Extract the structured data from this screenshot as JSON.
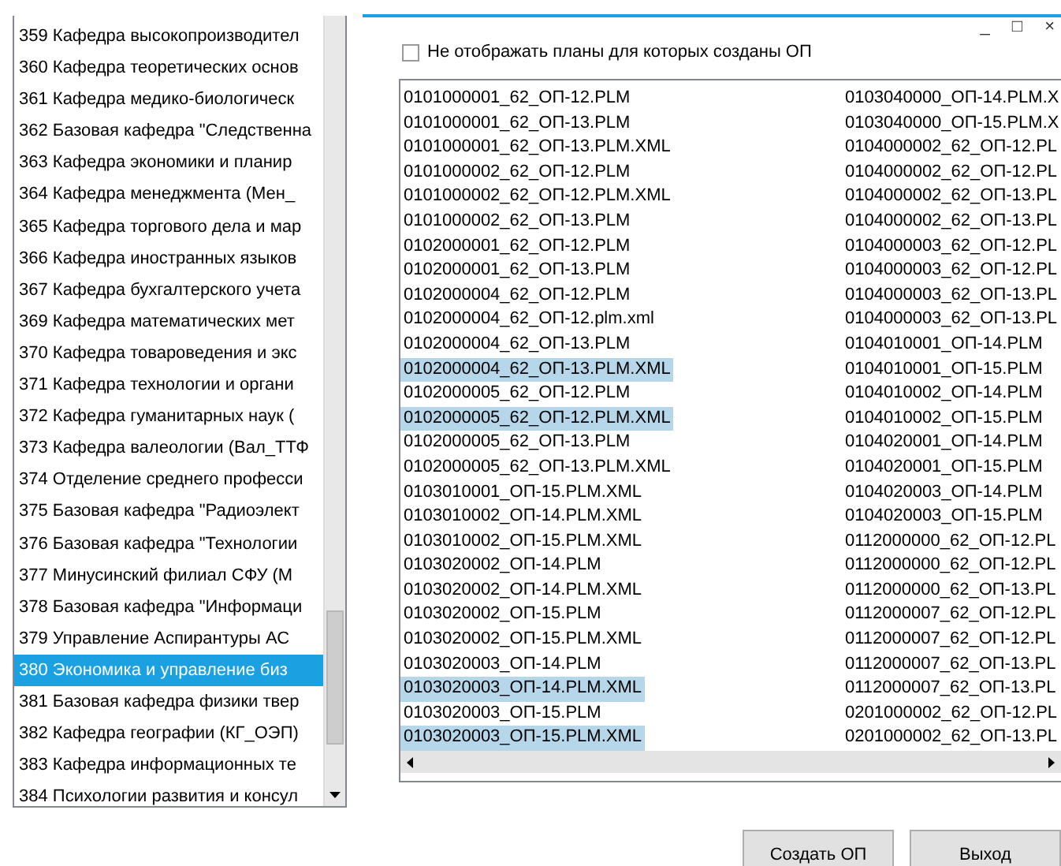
{
  "departments": [
    {
      "label": "359 Кафедра высокопроизводител",
      "selected": false
    },
    {
      "label": "360 Кафедра теоретических основ",
      "selected": false
    },
    {
      "label": "361 Кафедра медико-биологическ",
      "selected": false
    },
    {
      "label": "362 Базовая кафедра \"Следственна",
      "selected": false
    },
    {
      "label": "363 Кафедра экономики и планир",
      "selected": false
    },
    {
      "label": "364 Кафедра менеджмента (Мен_",
      "selected": false
    },
    {
      "label": "365 Кафедра торгового дела и мар",
      "selected": false
    },
    {
      "label": "366 Кафедра иностранных языков",
      "selected": false
    },
    {
      "label": "367 Кафедра бухгалтерского учета",
      "selected": false
    },
    {
      "label": "369 Кафедра математических мет",
      "selected": false
    },
    {
      "label": "370 Кафедра товароведения и экс",
      "selected": false
    },
    {
      "label": "371 Кафедра технологии и органи",
      "selected": false
    },
    {
      "label": "372 Кафедра гуманитарных наук (",
      "selected": false
    },
    {
      "label": "373 Кафедра валеологии (Вал_ТТФ",
      "selected": false
    },
    {
      "label": "374 Отделение среднего професси",
      "selected": false
    },
    {
      "label": "375 Базовая кафедра \"Радиоэлект",
      "selected": false
    },
    {
      "label": "376 Базовая кафедра \"Технологии",
      "selected": false
    },
    {
      "label": "377 Минусинский филиал СФУ (М",
      "selected": false
    },
    {
      "label": "378 Базовая кафедра \"Информаци",
      "selected": false
    },
    {
      "label": "379 Управление Аспирантуры АС",
      "selected": false
    },
    {
      "label": "380 Экономика и управление биз",
      "selected": true
    },
    {
      "label": "381 Базовая кафедра физики твер",
      "selected": false
    },
    {
      "label": "382 Кафедра географии (КГ_ОЭП)",
      "selected": false
    },
    {
      "label": "383 Кафедра информационных те",
      "selected": false
    },
    {
      "label": "384 Психологии развития и консул",
      "selected": false
    }
  ],
  "window": {
    "controls": [
      "_",
      "□",
      "×"
    ]
  },
  "filter_checkbox": {
    "label": "Не отображать планы  для которых созданы ОП",
    "checked": false
  },
  "files": [
    {
      "name": "0101000001_62_ОП-12.PLM",
      "selected": false
    },
    {
      "name": "0101000001_62_ОП-13.PLM",
      "selected": false
    },
    {
      "name": "0101000001_62_ОП-13.PLM.XML",
      "selected": false
    },
    {
      "name": "0101000002_62_ОП-12.PLM",
      "selected": false
    },
    {
      "name": "0101000002_62_ОП-12.PLM.XML",
      "selected": false
    },
    {
      "name": "0101000002_62_ОП-13.PLM",
      "selected": false
    },
    {
      "name": "0102000001_62_ОП-12.PLM",
      "selected": false
    },
    {
      "name": "0102000001_62_ОП-13.PLM",
      "selected": false
    },
    {
      "name": "0102000004_62_ОП-12.PLM",
      "selected": false
    },
    {
      "name": "0102000004_62_ОП-12.plm.xml",
      "selected": false
    },
    {
      "name": "0102000004_62_ОП-13.PLM",
      "selected": false
    },
    {
      "name": "0102000004_62_ОП-13.PLM.XML",
      "selected": true
    },
    {
      "name": "0102000005_62_ОП-12.PLM",
      "selected": false
    },
    {
      "name": "0102000005_62_ОП-12.PLM.XML",
      "selected": true
    },
    {
      "name": "0102000005_62_ОП-13.PLM",
      "selected": false
    },
    {
      "name": "0102000005_62_ОП-13.PLM.XML",
      "selected": false
    },
    {
      "name": "0103010001_ОП-15.PLM.XML",
      "selected": false
    },
    {
      "name": "0103010002_ОП-14.PLM.XML",
      "selected": false
    },
    {
      "name": "0103010002_ОП-15.PLM.XML",
      "selected": false
    },
    {
      "name": "0103020002_ОП-14.PLM",
      "selected": false
    },
    {
      "name": "0103020002_ОП-14.PLM.XML",
      "selected": false
    },
    {
      "name": "0103020002_ОП-15.PLM",
      "selected": false
    },
    {
      "name": "0103020002_ОП-15.PLM.XML",
      "selected": false
    },
    {
      "name": "0103020003_ОП-14.PLM",
      "selected": false
    },
    {
      "name": "0103020003_ОП-14.PLM.XML",
      "selected": true
    },
    {
      "name": "0103020003_ОП-15.PLM",
      "selected": false
    },
    {
      "name": "0103020003_ОП-15.PLM.XML",
      "selected": true
    },
    {
      "name": "0103040000_ОП-14.PLM.X",
      "selected": false
    },
    {
      "name": "0103040000_ОП-15.PLM.X",
      "selected": false
    },
    {
      "name": "0104000002_62_ОП-12.PL",
      "selected": false
    },
    {
      "name": "0104000002_62_ОП-12.PL",
      "selected": false
    },
    {
      "name": "0104000002_62_ОП-13.PL",
      "selected": false
    },
    {
      "name": "0104000002_62_ОП-13.PL",
      "selected": false
    },
    {
      "name": "0104000003_62_ОП-12.PL",
      "selected": false
    },
    {
      "name": "0104000003_62_ОП-12.PL",
      "selected": false
    },
    {
      "name": "0104000003_62_ОП-13.PL",
      "selected": false
    },
    {
      "name": "0104000003_62_ОП-13.PL",
      "selected": false
    },
    {
      "name": "0104010001_ОП-14.PLM",
      "selected": false
    },
    {
      "name": "0104010001_ОП-15.PLM",
      "selected": false
    },
    {
      "name": "0104010002_ОП-14.PLM",
      "selected": false
    },
    {
      "name": "0104010002_ОП-15.PLM",
      "selected": false
    },
    {
      "name": "0104020001_ОП-14.PLM",
      "selected": false
    },
    {
      "name": "0104020001_ОП-15.PLM",
      "selected": false
    },
    {
      "name": "0104020003_ОП-14.PLM",
      "selected": false
    },
    {
      "name": "0104020003_ОП-15.PLM",
      "selected": false
    },
    {
      "name": "0112000000_62_ОП-12.PL",
      "selected": false
    },
    {
      "name": "0112000000_62_ОП-12.PL",
      "selected": false
    },
    {
      "name": "0112000000_62_ОП-13.PL",
      "selected": false
    },
    {
      "name": "0112000007_62_ОП-12.PL",
      "selected": false
    },
    {
      "name": "0112000007_62_ОП-12.PL",
      "selected": false
    },
    {
      "name": "0112000007_62_ОП-13.PL",
      "selected": false
    },
    {
      "name": "0112000007_62_ОП-13.PL",
      "selected": false
    },
    {
      "name": "0201000002_62_ОП-12.PL",
      "selected": false
    },
    {
      "name": "0201000002_62_ОП-13.PL",
      "selected": false
    }
  ],
  "buttons": [
    "Создать ОП",
    "Выход"
  ]
}
